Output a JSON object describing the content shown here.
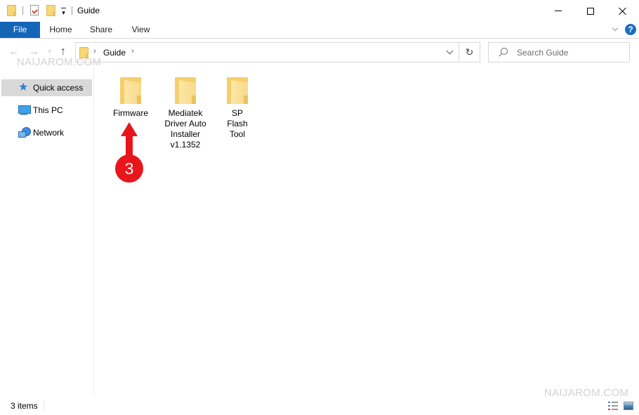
{
  "window": {
    "title": "Guide",
    "controls": {
      "minimize": "minimize",
      "maximize": "maximize",
      "close": "close"
    }
  },
  "quick_access_toolbar": {
    "icons": [
      "folder-icon",
      "properties-icon",
      "new-folder-icon",
      "customize-dropdown-icon"
    ]
  },
  "ribbon": {
    "tabs": [
      {
        "label": "File",
        "active": true
      },
      {
        "label": "Home"
      },
      {
        "label": "Share"
      },
      {
        "label": "View"
      }
    ],
    "help_label": "?",
    "accent_color": "#1565b7"
  },
  "navigation": {
    "back_glyph": "←",
    "forward_glyph": "→",
    "recent_glyph": "˅",
    "up_glyph": "↑",
    "address": {
      "path": [
        "Guide"
      ],
      "separator": "›",
      "refresh_glyph": "↻"
    },
    "search": {
      "placeholder": "Search Guide"
    }
  },
  "sidebar": {
    "items": [
      {
        "label": "Quick access",
        "icon": "star-icon",
        "selected": true
      },
      {
        "label": "This PC",
        "icon": "computer-icon"
      },
      {
        "label": "Network",
        "icon": "network-icon"
      }
    ]
  },
  "content": {
    "items": [
      {
        "name": "Firmware",
        "type": "folder"
      },
      {
        "name": "Mediatek Driver Auto Installer v1.1352",
        "type": "folder"
      },
      {
        "name": "SP Flash Tool",
        "type": "folder"
      }
    ],
    "annotation": {
      "number": "3",
      "color": "#e8161b",
      "points_to": "Firmware"
    }
  },
  "status_bar": {
    "item_count": "3 items"
  },
  "watermarks": {
    "top": "NAIJAROM.COM",
    "bottom": "NAIJAROM.COM"
  }
}
